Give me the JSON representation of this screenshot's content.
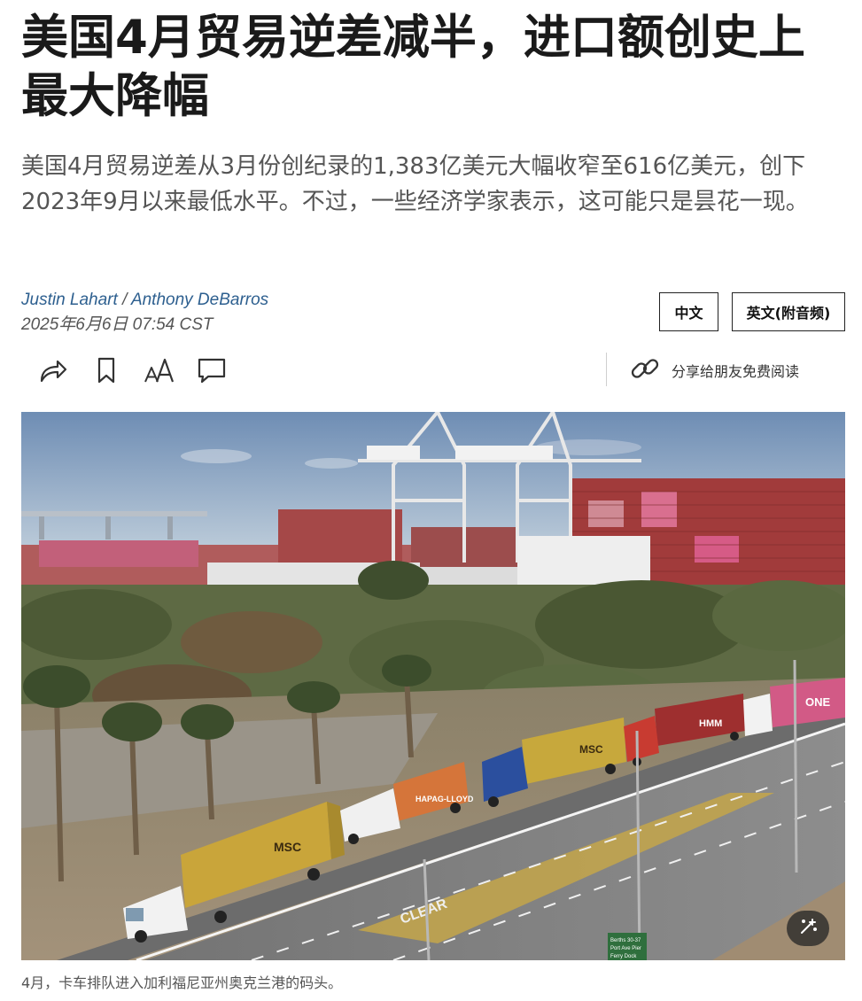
{
  "article": {
    "headline": "美国4月贸易逆差减半，进口额创史上最大降幅",
    "dek": "美国4月贸易逆差从3月份创纪录的1,383亿美元大幅收窄至616亿美元，创下2023年9月以来最低水平。不过，一些经济学家表示，这可能只是昙花一现。",
    "authors": [
      "Justin Lahart",
      "Anthony DeBarros"
    ],
    "author_separator": " / ",
    "timestamp": "2025年6月6日 07:54 CST"
  },
  "language_buttons": {
    "chinese": "中文",
    "english": "英文(附音频)"
  },
  "toolbar": {
    "icons": [
      "share-icon",
      "bookmark-icon",
      "text-size-icon",
      "comment-icon"
    ],
    "gift_label": "分享给朋友免费阅读",
    "gift_icon": "link-icon"
  },
  "image": {
    "caption": "4月，卡车排队进入加利福尼亚州奥克兰港的码头。",
    "container_text": {
      "truck_1": "MSC",
      "truck_2": "HAPAG-LLOYD",
      "truck_3": "MSC",
      "truck_4": "HMM",
      "truck_5": "ONE"
    },
    "road_text": "CLEAR",
    "sign_lines": [
      "Berths 30-37",
      "Port Ave Pier",
      "Ferry Dock"
    ],
    "zoom_icon": "expand-icon"
  },
  "colors": {
    "author_link": "#2d5f8f",
    "headline": "#1a1a1a",
    "dek": "#555555"
  }
}
